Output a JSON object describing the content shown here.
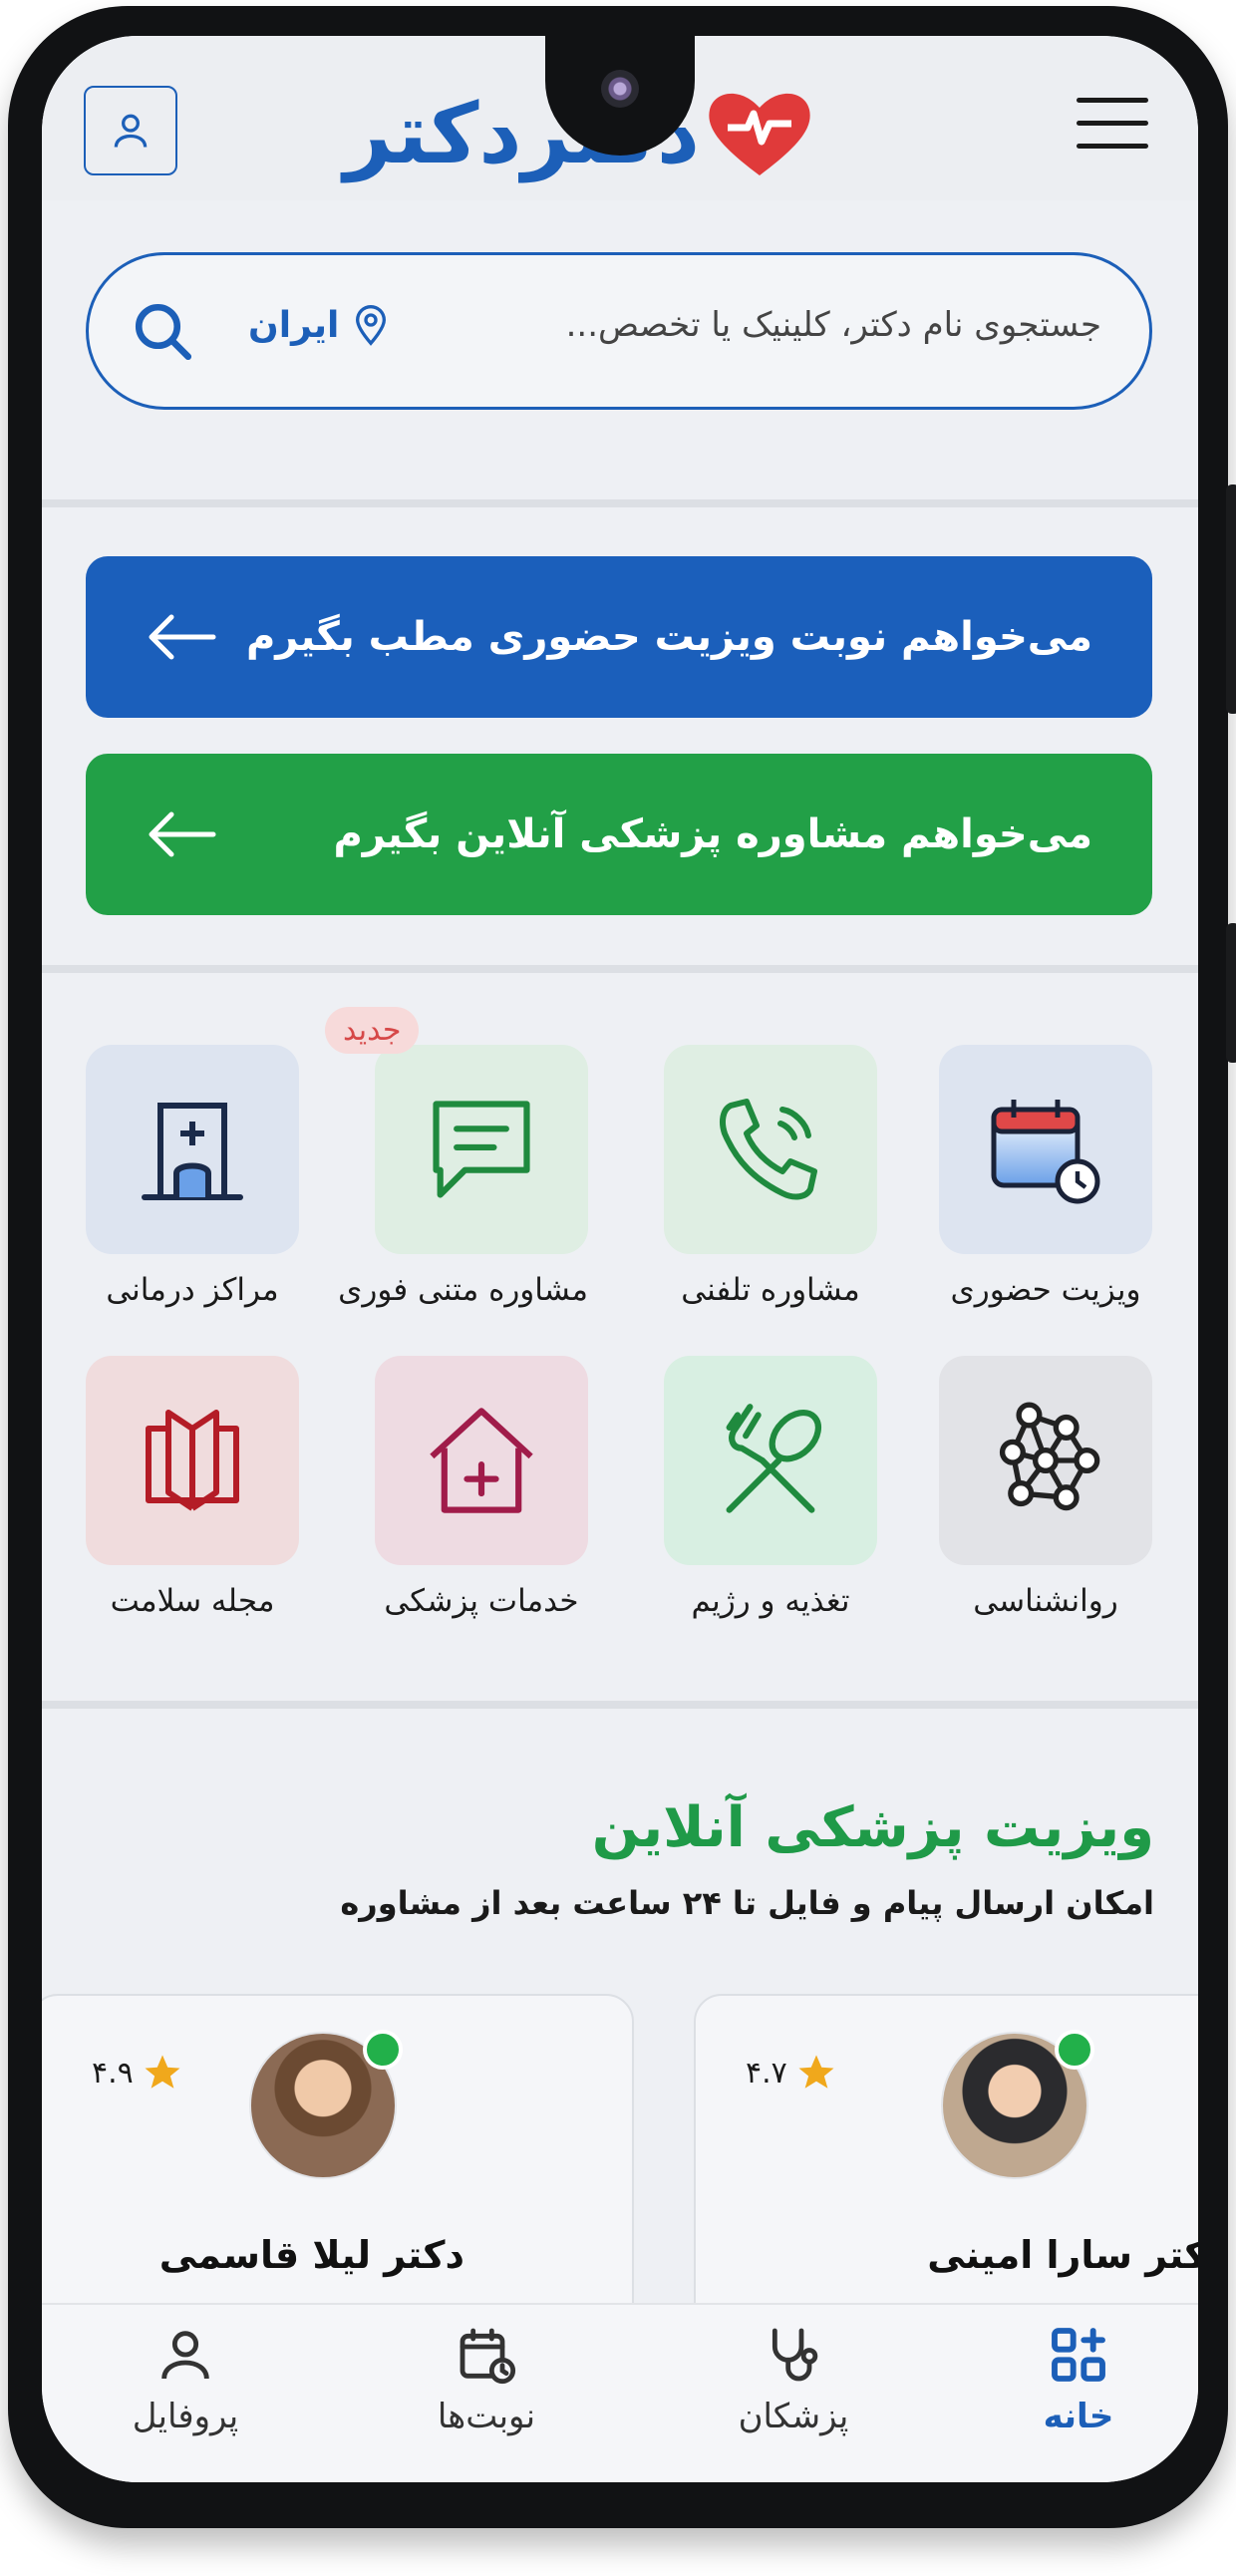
{
  "header": {
    "logo_text": "دکتردکتر"
  },
  "search": {
    "placeholder": "جستجوی نام دکتر، کلینیک یا تخصص...",
    "location": "ایران"
  },
  "cta": {
    "in_person": "می‌خواهم نوبت ویزیت حضوری مطب بگیرم",
    "online": "می‌خواهم مشاوره پزشکی آنلاین بگیرم"
  },
  "services": [
    {
      "label": "ویزیت حضوری",
      "icon": "calendar-clock-icon"
    },
    {
      "label": "مشاوره تلفنی",
      "icon": "phone-call-icon"
    },
    {
      "label": "مشاوره متنی فوری",
      "icon": "chat-icon",
      "badge": "جدید"
    },
    {
      "label": "مراکز درمانی",
      "icon": "hospital-icon"
    },
    {
      "label": "روانشناسی",
      "icon": "brain-network-icon"
    },
    {
      "label": "تغذیه و رژیم",
      "icon": "fork-spoon-icon"
    },
    {
      "label": "خدمات پزشکی",
      "icon": "home-plus-icon"
    },
    {
      "label": "مجله سلامت",
      "icon": "book-icon"
    }
  ],
  "online_section": {
    "title": "ویزیت پزشکی آنلاین",
    "subtitle": "امکان ارسال پیام و فایل تا ۲۴ ساعت بعد از مشاوره"
  },
  "doctors": [
    {
      "name": "دکتر سارا امینی",
      "rating": "۴.۷"
    },
    {
      "name": "دکتر لیلا قاسمی",
      "rating": "۴.۹"
    }
  ],
  "bottom_nav": [
    {
      "label": "خانه",
      "icon": "home-grid-icon",
      "active": true
    },
    {
      "label": "پزشکان",
      "icon": "stethoscope-icon",
      "active": false
    },
    {
      "label": "نوبت‌ها",
      "icon": "calendar-icon",
      "active": false
    },
    {
      "label": "پروفایل",
      "icon": "user-icon",
      "active": false
    }
  ],
  "colors": {
    "primary": "#1b5fbb",
    "green": "#22a047",
    "badge_text": "#d64848"
  }
}
